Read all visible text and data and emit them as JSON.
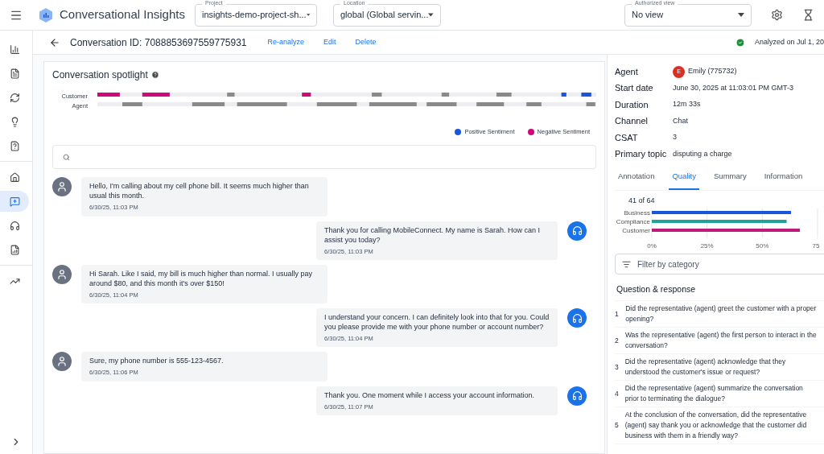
{
  "app": {
    "title": "Conversational Insights"
  },
  "selectors": [
    {
      "label": "Project",
      "value": "insights-demo-project-sh..."
    },
    {
      "label": "Location",
      "value": "global (Global servin..."
    },
    {
      "label": "Authorized view",
      "value": "No view"
    }
  ],
  "nav_items": [
    {
      "selected": false
    },
    {
      "selected": false
    },
    {
      "selected": false
    },
    {
      "selected": false
    },
    {
      "selected": false
    },
    {
      "selected": false
    },
    {
      "selected": true
    },
    {
      "selected": false
    },
    {
      "selected": false
    },
    {
      "selected": false
    }
  ],
  "header": {
    "title": "Conversation ID: 7088853697559775931",
    "actions": [
      "Re-analyze",
      "Edit",
      "Delete"
    ],
    "status": "Analyzed on Jul 1, 20"
  },
  "spotlight": {
    "title": "Conversation spotlight",
    "rows": [
      "Customer",
      "Agent"
    ],
    "legend": [
      {
        "label": "Positive Sentiment",
        "color": "#1a56db"
      },
      {
        "label": "Negative Sentiment",
        "color": "#d0097a"
      }
    ]
  },
  "messages": [
    {
      "kind": "customer",
      "text": "Hello, I'm calling about my cell phone bill. It seems much higher than usual this month.",
      "time": "6/30/25, 11:03 PM"
    },
    {
      "kind": "agent",
      "text": "Thank you for calling MobileConnect. My name is Sarah. How can I assist you today?",
      "time": "6/30/25, 11:03 PM"
    },
    {
      "kind": "customer",
      "text": "Hi Sarah. Like I said, my bill is much higher than normal. I usually pay around $80, and this month it's over $150!",
      "time": "6/30/25, 11:04 PM"
    },
    {
      "kind": "agent",
      "text": "I understand your concern. I can definitely look into that for you. Could you please provide me with your phone number or account number?",
      "time": "6/30/25, 11:04 PM"
    },
    {
      "kind": "customer",
      "text": "Sure, my phone number is 555-123-4567.",
      "time": "6/30/25, 11:06 PM"
    },
    {
      "kind": "agent",
      "text": "Thank you. One moment while I access your account information.",
      "time": "6/30/25, 11:07 PM"
    }
  ],
  "details": {
    "agent_initial": "E",
    "rows": [
      {
        "label": "Agent",
        "value": "Emily (775732)"
      },
      {
        "label": "Start date",
        "value": "June 30, 2025 at 11:03:01 PM GMT-3"
      },
      {
        "label": "Duration",
        "value": "12m 33s"
      },
      {
        "label": "Channel",
        "value": "Chat"
      },
      {
        "label": "CSAT",
        "value": "3"
      },
      {
        "label": "Primary topic",
        "value": "disputing a charge"
      }
    ]
  },
  "tabs": [
    {
      "label": "Annotation",
      "selected": false
    },
    {
      "label": "Quality",
      "selected": true
    },
    {
      "label": "Summary",
      "selected": false
    },
    {
      "label": "Information",
      "selected": false
    }
  ],
  "quality": {
    "score_count": "41 of 64",
    "chart_data": {
      "type": "bar",
      "orientation": "horizontal",
      "categories": [
        "Business",
        "Compliance",
        "Customer"
      ],
      "values": [
        63,
        61,
        67
      ],
      "colors": [
        "#1a56db",
        "#1fa39a",
        "#c2187a"
      ],
      "xlim": [
        0,
        75
      ],
      "xticks": [
        {
          "value": 0,
          "label": "0%"
        },
        {
          "value": 25,
          "label": "25%"
        },
        {
          "value": 50,
          "label": "50%"
        },
        {
          "value": 75,
          "label": "75"
        }
      ]
    },
    "filter_placeholder": "Filter by category",
    "section_title": "Question & response",
    "questions": [
      {
        "number": "1",
        "text": "Did the representative (agent) greet the customer with a proper opening?"
      },
      {
        "number": "2",
        "text": "Was the representative (agent) the first person to interact in the conversation?"
      },
      {
        "number": "3",
        "text": "Did the representative (agent) acknowledge that they understood the customer's issue or request?"
      },
      {
        "number": "4",
        "text": "Did the representative (agent) summarize the conversation prior to terminating the dialogue?"
      },
      {
        "number": "5",
        "text": "At the conclusion of the conversation, did the representative (agent) say thank you or acknowledge that the customer did business with them in a friendly way?"
      }
    ]
  }
}
